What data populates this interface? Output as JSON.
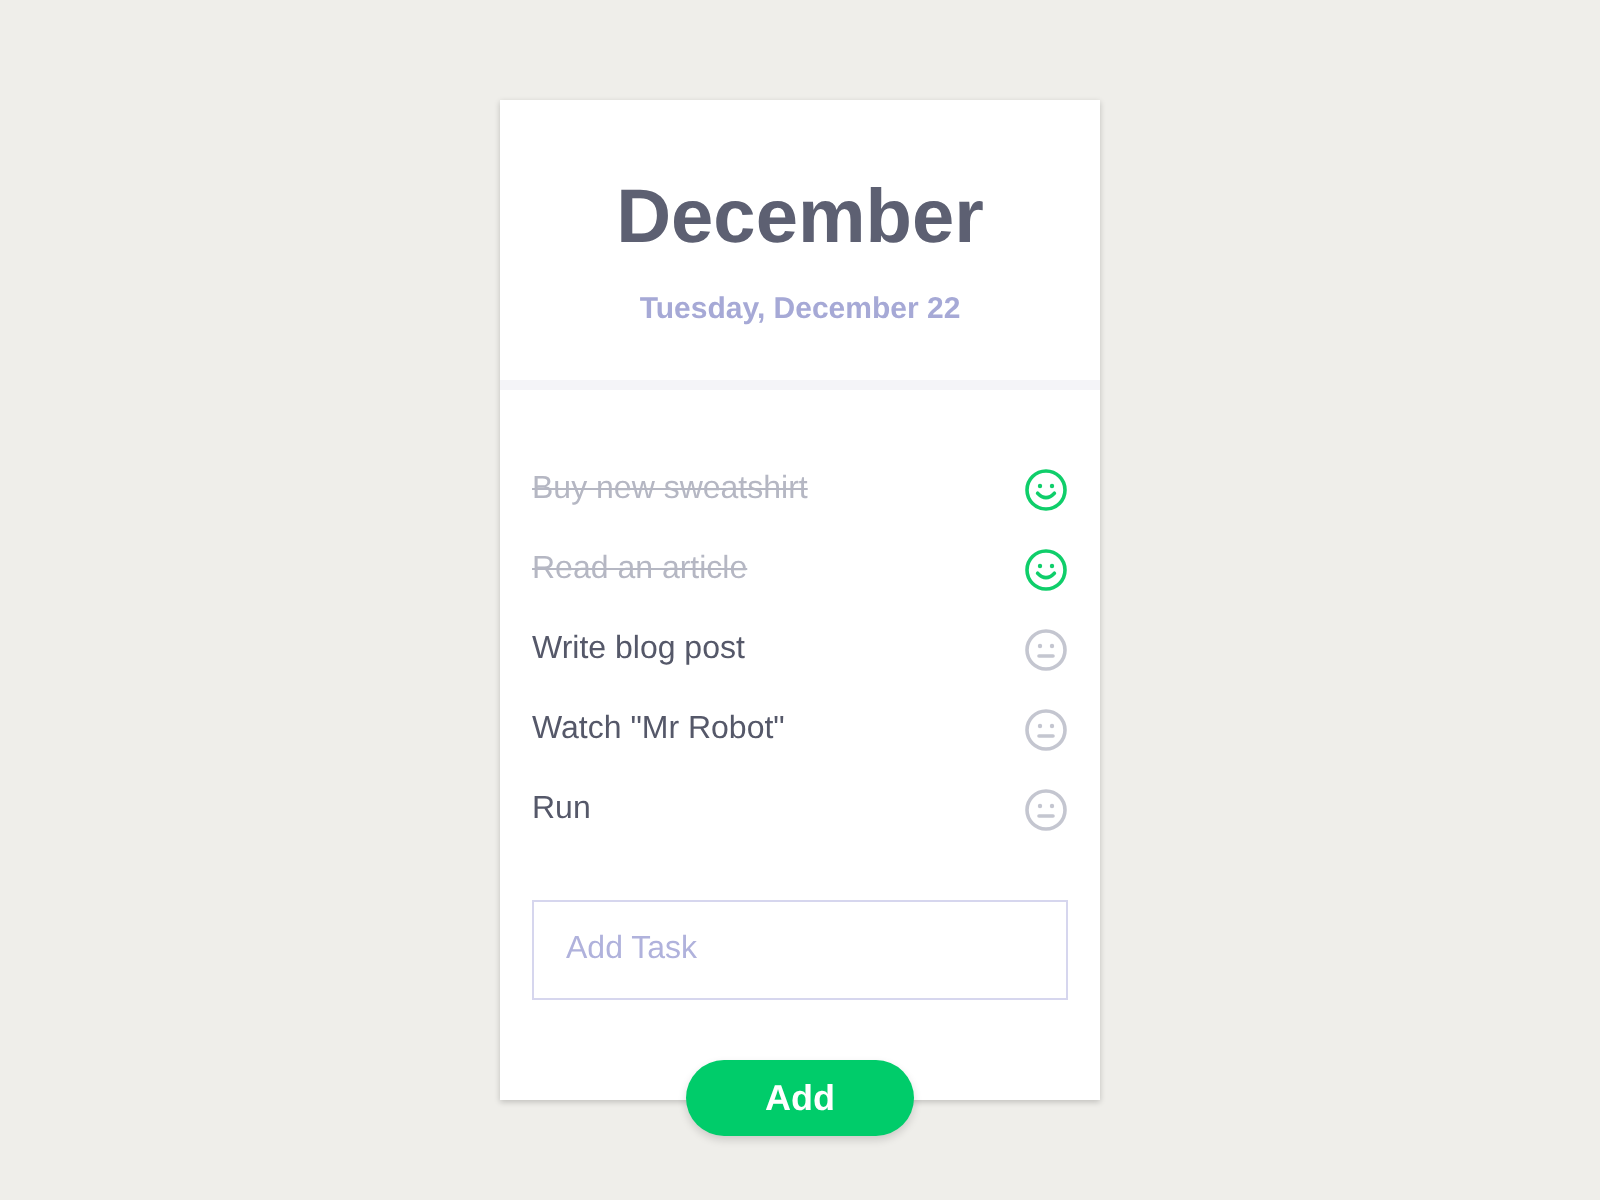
{
  "header": {
    "month": "December",
    "date": "Tuesday, December 22"
  },
  "tasks": [
    {
      "text": "Buy new sweatshirt",
      "done": true
    },
    {
      "text": "Read an article",
      "done": true
    },
    {
      "text": "Write blog post",
      "done": false
    },
    {
      "text": "Watch \"Mr Robot\"",
      "done": false
    },
    {
      "text": "Run",
      "done": false
    }
  ],
  "input": {
    "placeholder": "Add Task"
  },
  "button": {
    "label": "Add"
  }
}
